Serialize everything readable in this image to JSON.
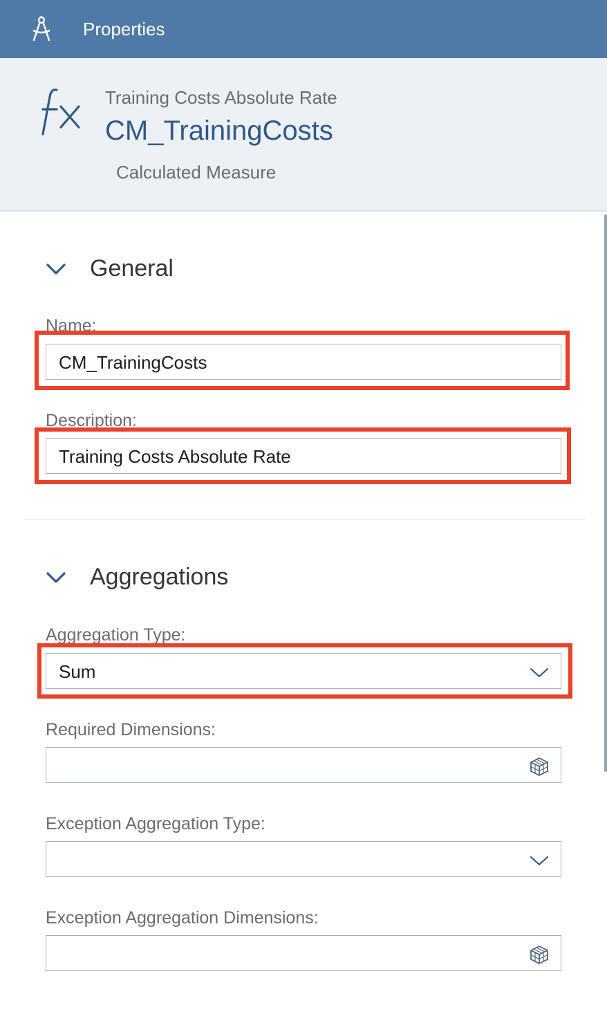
{
  "topbar": {
    "title": "Properties",
    "icon": "compass-icon"
  },
  "header": {
    "icon": "fx-icon",
    "subtitle": "Training Costs Absolute Rate",
    "title": "CM_TrainingCosts",
    "type": "Calculated Measure"
  },
  "sections": {
    "general": {
      "title": "General",
      "name_label": "Name:",
      "name_value": "CM_TrainingCosts",
      "description_label": "Description:",
      "description_value": "Training Costs Absolute Rate"
    },
    "aggregations": {
      "title": "Aggregations",
      "aggregation_type_label": "Aggregation Type:",
      "aggregation_type_value": "Sum",
      "required_dimensions_label": "Required Dimensions:",
      "required_dimensions_value": "",
      "exception_type_label": "Exception Aggregation Type:",
      "exception_type_value": "",
      "exception_dimensions_label": "Exception Aggregation Dimensions:",
      "exception_dimensions_value": ""
    }
  },
  "colors": {
    "shell": "#4f7aa8",
    "header_bg": "#edf1f6",
    "title_blue": "#2f5a89",
    "highlight": "#e8432a"
  }
}
